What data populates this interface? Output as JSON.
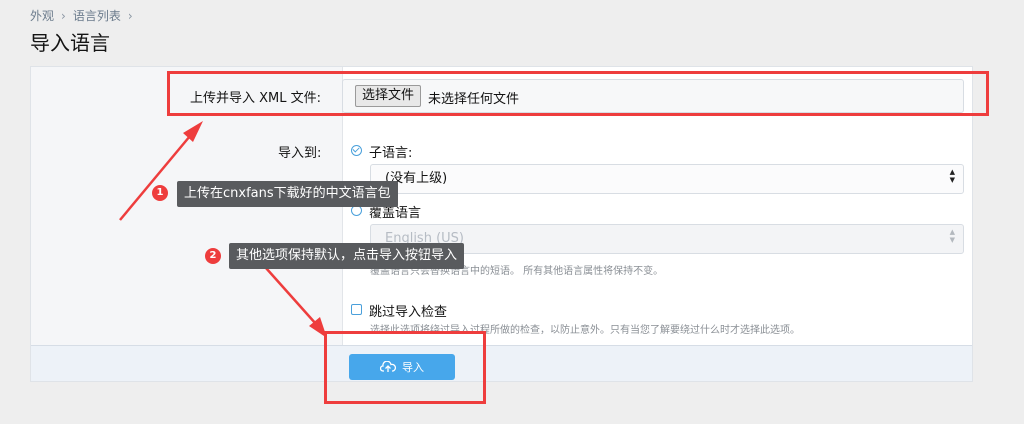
{
  "breadcrumb": {
    "items": [
      "外观",
      "语言列表"
    ]
  },
  "page": {
    "title": "导入语言"
  },
  "form": {
    "upload_label": "上传并导入 XML 文件:",
    "file_button_label": "选择文件",
    "file_status": "未选择任何文件",
    "import_to_label": "导入到:",
    "child_language_label": "子语言:",
    "child_language_select_value": "(没有上级)",
    "overwrite_label": "覆盖语言",
    "overwrite_select_value": "English (US)",
    "overwrite_hint": "覆盖语言只会替换语言中的短语。 所有其他语言属性将保持不变。",
    "skip_check_label": "跳过导入检查",
    "skip_check_hint": "选择此选项将绕过导入过程所做的检查，以防止意外。只有当您了解要绕过什么时才选择此选项。",
    "import_button_label": "导入"
  },
  "annotations": [
    {
      "badge": "1",
      "text": "上传在cnxfans下载好的中文语言包"
    },
    {
      "badge": "2",
      "text": "其他选项保持默认，点击导入按钮导入"
    }
  ],
  "colors": {
    "accent": "#47a7eb",
    "annotation_red": "#ee3d3d",
    "tooltip_bg": "#595b5e"
  }
}
